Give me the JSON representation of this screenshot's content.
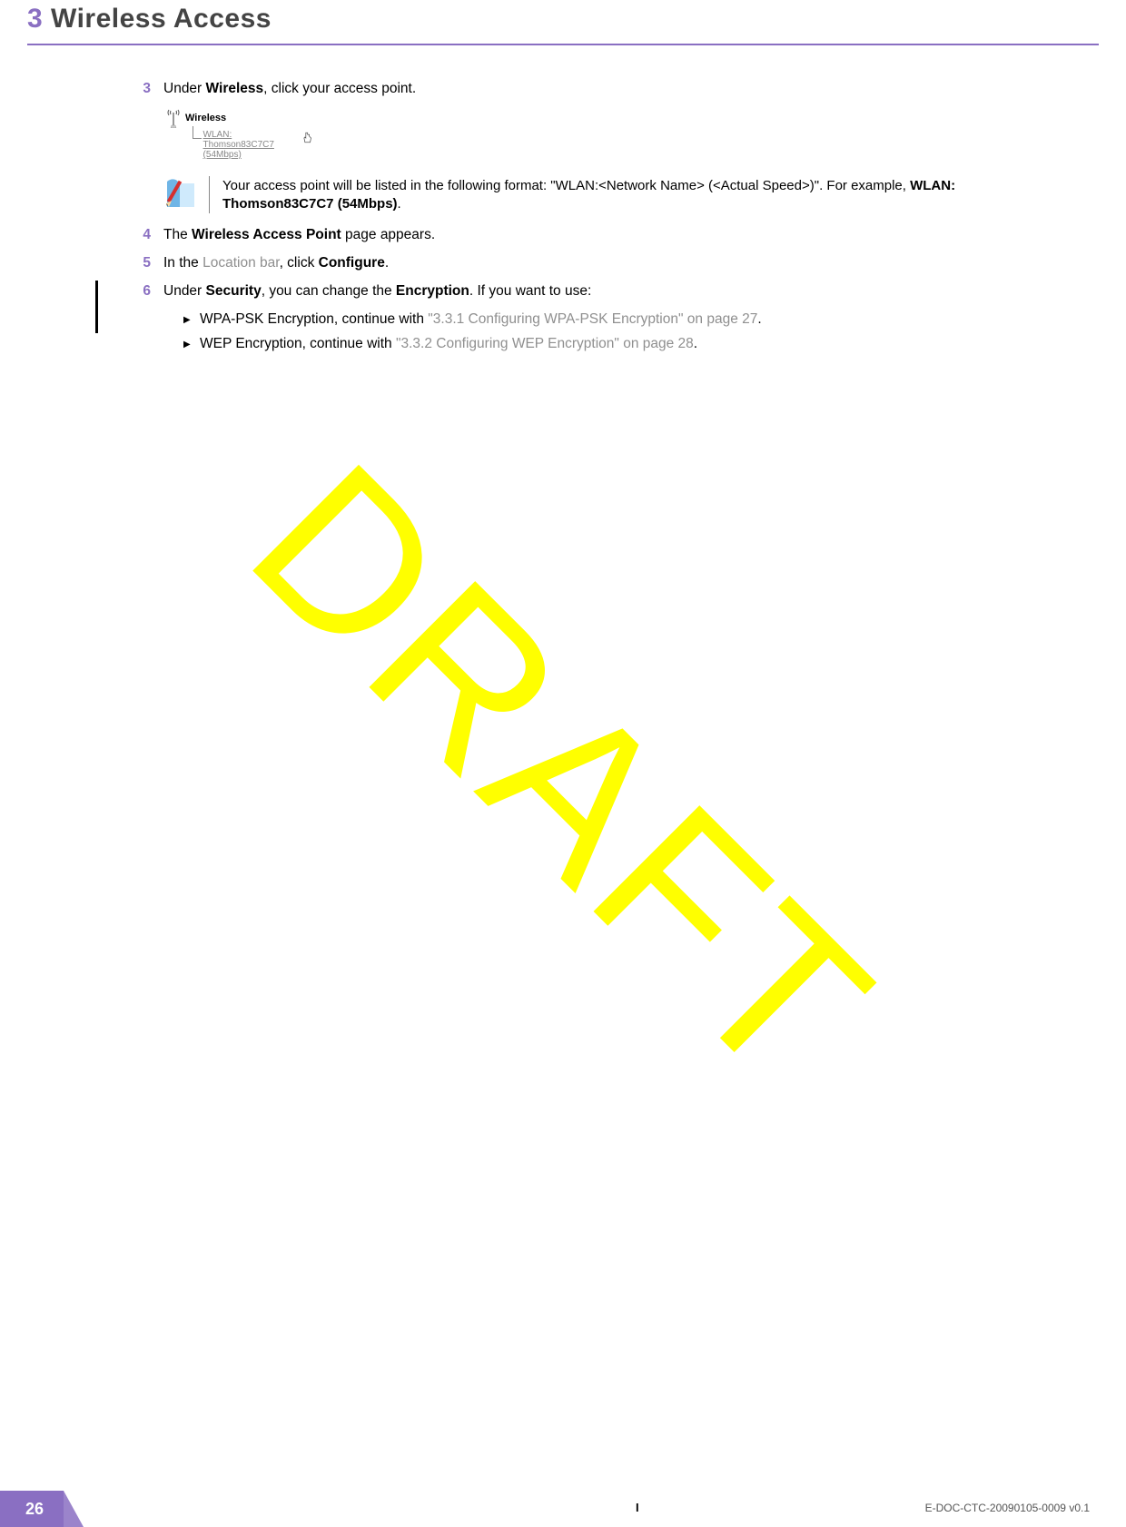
{
  "header": {
    "chapter_num": "3",
    "chapter_title": "Wireless Access"
  },
  "steps": {
    "s3": {
      "num": "3",
      "pre": "Under ",
      "bold": "Wireless",
      "post": ", click your access point."
    },
    "mini": {
      "label_wireless": "Wireless",
      "label_wlan_line1": "WLAN: Thomson83C7C7",
      "label_wlan_line2": "(54Mbps)"
    },
    "note": {
      "part1": "Your access point will be listed in the following format: \"WLAN:<Network Name> (<Actual Speed>)\". For example, ",
      "bold": "WLAN: Thomson83C7C7 (54Mbps)",
      "part2": "."
    },
    "s4": {
      "num": "4",
      "pre": "The ",
      "bold": "Wireless Access Point",
      "post": " page appears."
    },
    "s5": {
      "num": "5",
      "pre": "In the ",
      "gray": "Location bar",
      "mid": ", click ",
      "bold": "Configure",
      "post": "."
    },
    "s6": {
      "num": "6",
      "pre": "Under ",
      "bold1": "Security",
      "mid": ", you can change the ",
      "bold2": "Encryption",
      "post": ". If you want to use:"
    },
    "bullets": {
      "b1": {
        "lead": "WPA-PSK Encryption, continue with ",
        "link": "\"3.3.1 Configuring WPA-PSK Encryption\" on page 27",
        "post": "."
      },
      "b2": {
        "lead": "WEP Encryption, continue with ",
        "link": "\"3.3.2 Configuring WEP Encryption\" on page 28",
        "post": "."
      }
    }
  },
  "watermark": "DRAFT",
  "footer": {
    "page_num": "26",
    "doc_id": "E-DOC-CTC-20090105-0009 v0.1",
    "mark": "I"
  }
}
